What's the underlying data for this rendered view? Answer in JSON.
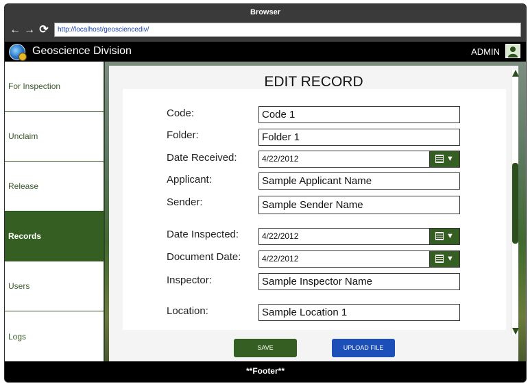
{
  "browser": {
    "title": "Browser",
    "url": "http://localhost/geosciencediv/",
    "back_icon": "←",
    "forward_icon": "→",
    "refresh_icon": "⟳"
  },
  "app": {
    "title": "Geoscience Division",
    "user": "ADMIN"
  },
  "sidebar": {
    "items": [
      {
        "label": "For Inspection"
      },
      {
        "label": "Unclaim"
      },
      {
        "label": "Release"
      },
      {
        "label": "Records",
        "active": true
      },
      {
        "label": "Users"
      },
      {
        "label": "Logs"
      }
    ]
  },
  "form": {
    "title": "EDIT RECORD",
    "fields": {
      "code": {
        "label": "Code:",
        "value": "Code 1"
      },
      "folder": {
        "label": "Folder:",
        "value": "Folder 1"
      },
      "date_received": {
        "label": "Date Received:",
        "value": "4/22/2012"
      },
      "applicant": {
        "label": "Applicant:",
        "value": "Sample Applicant Name"
      },
      "sender": {
        "label": "Sender:",
        "value": "Sample Sender Name"
      },
      "date_inspected": {
        "label": "Date Inspected:",
        "value": "4/22/2012"
      },
      "document_date": {
        "label": "Document Date:",
        "value": "4/22/2012"
      },
      "inspector": {
        "label": "Inspector:",
        "value": "Sample Inspector Name"
      },
      "location": {
        "label": "Location:",
        "value": "Sample Location 1"
      }
    },
    "save_label": "SAVE",
    "upload_label": "UPLOAD FILE"
  },
  "footer": {
    "text": "**Footer**"
  },
  "colors": {
    "accent": "#355e22",
    "upload": "#1d4fb8"
  }
}
